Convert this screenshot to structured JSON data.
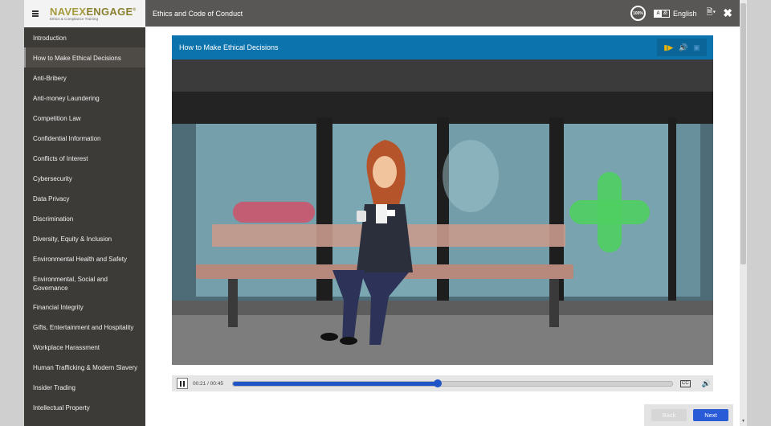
{
  "brand": {
    "name_part1": "NAVEX",
    "name_part2": "ENGAGE",
    "tagline": "Ethics & Compliance Training",
    "trademark": "®"
  },
  "topbar": {
    "course_title": "Ethics and Code of Conduct",
    "zoom_level": "100%",
    "language": "English",
    "language_icon_left": "A",
    "language_icon_right": "あ"
  },
  "sidebar": {
    "items": [
      {
        "label": "Introduction",
        "active": false
      },
      {
        "label": "How to Make Ethical Decisions",
        "active": true
      },
      {
        "label": "Anti-Bribery",
        "active": false
      },
      {
        "label": "Anti-money Laundering",
        "active": false
      },
      {
        "label": "Competition Law",
        "active": false
      },
      {
        "label": "Confidential Information",
        "active": false
      },
      {
        "label": "Conflicts of Interest",
        "active": false
      },
      {
        "label": "Cybersecurity",
        "active": false
      },
      {
        "label": "Data Privacy",
        "active": false
      },
      {
        "label": "Discrimination",
        "active": false
      },
      {
        "label": "Diversity, Equity & Inclusion",
        "active": false
      },
      {
        "label": "Environmental Health and Safety",
        "active": false
      },
      {
        "label": "Environmental, Social and Governance",
        "active": false
      },
      {
        "label": "Financial Integrity",
        "active": false
      },
      {
        "label": "Gifts, Entertainment and Hospitality",
        "active": false
      },
      {
        "label": "Workplace Harassment",
        "active": false
      },
      {
        "label": "Human Trafficking & Modern Slavery",
        "active": false
      },
      {
        "label": "Insider Trading",
        "active": false
      },
      {
        "label": "Intellectual Property",
        "active": false
      }
    ]
  },
  "player": {
    "title": "How to Make Ethical Decisions",
    "media_icons": [
      "video-camera-icon",
      "audio-icon",
      "image-icon"
    ],
    "time_display": "00:21 / 00:45",
    "progress_fraction": 0.4667,
    "cc_label": "CC"
  },
  "navigation": {
    "back_label": "Back",
    "next_label": "Next"
  },
  "colors": {
    "accent": "#0d73ac",
    "primary_button": "#2a5bd7",
    "sidebar_bg": "#3d3b38",
    "topbar_bg": "#595755",
    "brand_gold": "#a59a3c"
  }
}
